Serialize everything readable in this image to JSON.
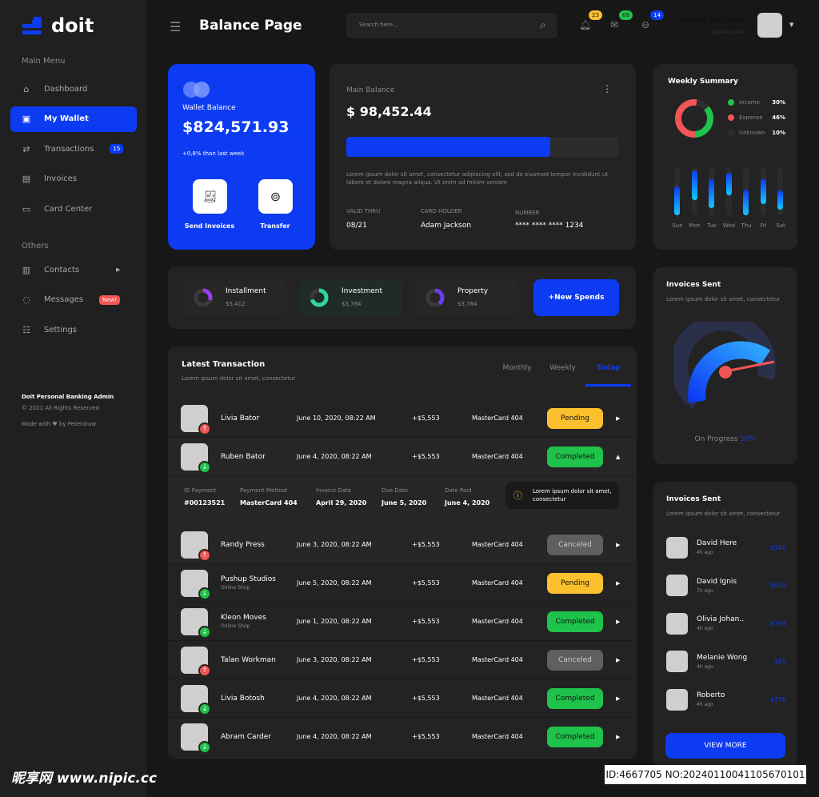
{
  "brand": {
    "name": "doit",
    "accent": "#0d3bf2"
  },
  "header": {
    "title": "Balance Page",
    "search_placeholder": "Search here...",
    "notifications": "23",
    "messages": "68",
    "cart": "14",
    "user_name": "Adam Jackson",
    "user_handle": "@adamjackson"
  },
  "sidebar": {
    "main_menu": "Main Menu",
    "others": "Others",
    "items": [
      {
        "label": "Dashboard",
        "icon": "home-icon"
      },
      {
        "label": "My Wallet",
        "icon": "wallet-icon",
        "active": true
      },
      {
        "label": "Transactions",
        "icon": "transfer-icon",
        "badge": "15"
      },
      {
        "label": "Invoices",
        "icon": "document-icon"
      },
      {
        "label": "Card Center",
        "icon": "card-icon"
      }
    ],
    "other_items": [
      {
        "label": "Contacts",
        "icon": "contacts-icon"
      },
      {
        "label": "Messages",
        "icon": "chat-icon",
        "badge": "New!"
      },
      {
        "label": "Settings",
        "icon": "settings-icon"
      }
    ],
    "footer_title": "Doit Personal Banking Admin",
    "footer_rights": "© 2021 All Rights Reserved",
    "footer_made": "Made with ♥ by Peterdraw"
  },
  "wallet": {
    "label": "Wallet Balance",
    "amount": "$824,571.93",
    "change": "+0,8% than last week",
    "send": "Send Invoices",
    "transfer": "Transfer"
  },
  "main_balance": {
    "label": "Main Balance",
    "amount": "$ 98,452.44",
    "progress": 0.75,
    "desc": "Lorem ipsum dolor sit amet, consectetur adipiscing elit, sed do eiusmod tempor incididunt ut labore et dolore magna aliqua. Ut enim ad minim veniam",
    "valid_label": "VALID THRU",
    "valid": "08/21",
    "holder_label": "CARD HOLDER",
    "holder": "Adam Jackson",
    "number_label": "NUMBER",
    "number": "**** **** **** 1234"
  },
  "spends": [
    {
      "label": "Installment",
      "amount": "$5,412",
      "color": "#9b3df2",
      "pct": 0.3
    },
    {
      "label": "Investment",
      "amount": "$3,784",
      "color": "#2fd6a0",
      "pct": 0.7
    },
    {
      "label": "Property",
      "amount": "$3,784",
      "color": "#6a3df2",
      "pct": 0.4
    }
  ],
  "new_spends": "+New Spends",
  "transactions": {
    "title": "Latest Transaction",
    "subtitle": "Lorem ipsum dolor sit amet, consectetur",
    "tabs": [
      "Monthly",
      "Weekly",
      "Today"
    ],
    "active_tab": 2,
    "rows": [
      {
        "name": "Livia Bator",
        "sub": "",
        "date": "June 10, 2020, 08:22 AM",
        "amount": "+$5,553",
        "method": "MasterCard 404",
        "status": "Pending",
        "dir": "out"
      },
      {
        "name": "Ruben Bator",
        "sub": "",
        "date": "June 4, 2020, 08:22 AM",
        "amount": "+$5,553",
        "method": "MasterCard 404",
        "status": "Completed",
        "dir": "in",
        "expanded": true
      },
      {
        "name": "Randy Press",
        "sub": "",
        "date": "June 3, 2020, 08:22 AM",
        "amount": "+$5,553",
        "method": "MasterCard 404",
        "status": "Canceled",
        "dir": "out"
      },
      {
        "name": "Pushup Studios",
        "sub": "Online Shop",
        "date": "June 5, 2020, 08:22 AM",
        "amount": "+$5,553",
        "method": "MasterCard 404",
        "status": "Pending",
        "dir": "in"
      },
      {
        "name": "Kleon Moves",
        "sub": "Online Shop",
        "date": "June 1, 2020, 08:22 AM",
        "amount": "+$5,553",
        "method": "MasterCard 404",
        "status": "Completed",
        "dir": "in"
      },
      {
        "name": "Talan Workman",
        "sub": "",
        "date": "June 3, 2020, 08:22 AM",
        "amount": "+$5,553",
        "method": "MasterCard 404",
        "status": "Canceled",
        "dir": "out"
      },
      {
        "name": "Livia Botosh",
        "sub": "",
        "date": "June 4, 2020, 08:22 AM",
        "amount": "+$5,553",
        "method": "MasterCard 404",
        "status": "Completed",
        "dir": "in"
      },
      {
        "name": "Abram Carder",
        "sub": "",
        "date": "June 4, 2020, 08:22 AM",
        "amount": "+$5,553",
        "method": "MasterCard 404",
        "status": "Completed",
        "dir": "in"
      }
    ],
    "details": [
      {
        "label": "ID Payment",
        "value": "#00123521"
      },
      {
        "label": "Payment Method",
        "value": "MasterCard 404"
      },
      {
        "label": "Invoice Date",
        "value": "April 29, 2020"
      },
      {
        "label": "Due Date",
        "value": "June 5, 2020"
      },
      {
        "label": "Date Paid",
        "value": "June 4, 2020"
      }
    ],
    "note": "Lorem ipsum dolor sit amet, consectetur",
    "status_colors": {
      "Pending": "#fbc02d",
      "Completed": "#1fc24a",
      "Canceled": "#5f5f5f"
    }
  },
  "weekly": {
    "title": "Weekly Summary",
    "legend": [
      {
        "label": "Income",
        "value": "30%",
        "color": "#1fc24a"
      },
      {
        "label": "Expense",
        "value": "46%",
        "color": "#f25555"
      },
      {
        "label": "Unknown",
        "value": "10%",
        "color": "#2e2e2e"
      }
    ],
    "days": [
      "Sun",
      "Mon",
      "Tue",
      "Wed",
      "Thu",
      "Fri",
      "Sat"
    ],
    "ranges": [
      [
        0,
        0.6
      ],
      [
        0.32,
        0.93
      ],
      [
        0.15,
        0.75
      ],
      [
        0.42,
        0.88
      ],
      [
        0,
        0.53
      ],
      [
        0.23,
        0.75
      ],
      [
        0.12,
        0.51
      ]
    ]
  },
  "gauge": {
    "title": "Invoices Sent",
    "subtitle": "Lorem ipsum dolor sit amet, consectetur",
    "label": "On Progress",
    "value": "50%"
  },
  "invoices": {
    "title": "Invoices Sent",
    "subtitle": "Lorem ipsum dolor sit amet, consectetur",
    "view_more": "VIEW MORE",
    "items": [
      {
        "name": "David Here",
        "time": "4h ago",
        "amount": "$562"
      },
      {
        "name": "David Ignis",
        "time": "7h ago",
        "amount": "$672"
      },
      {
        "name": "Olivia Johan..",
        "time": "4h ago",
        "amount": "$769"
      },
      {
        "name": "Melanie Wong",
        "time": "4h ago",
        "amount": "$45"
      },
      {
        "name": "Roberto",
        "time": "4h ago",
        "amount": "$776"
      }
    ]
  },
  "watermark": {
    "left": "昵享网 www.nipic.cc",
    "right": "ID:4667705 NO:20240110041105670101"
  }
}
